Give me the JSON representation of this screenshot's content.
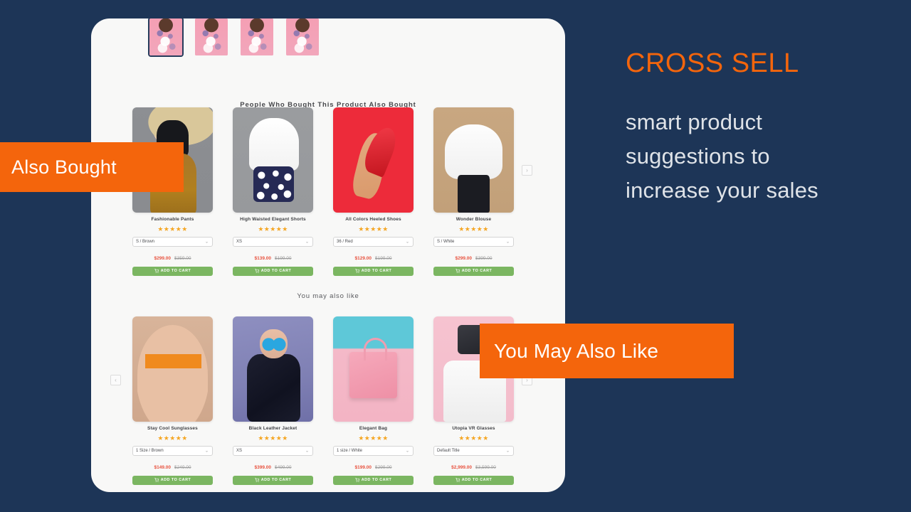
{
  "colors": {
    "background": "#1d3557",
    "accent_orange": "#f4650c",
    "card_background": "#f8f8f7",
    "cart_button_green": "#7bb661",
    "sale_price_red": "#e8523f",
    "star_yellow": "#f5a623"
  },
  "right_panel": {
    "headline": "CROSS SELL",
    "sub_lines": [
      "smart product",
      "suggestions to",
      "increase your sales"
    ]
  },
  "callouts": {
    "also_bought": "Also Bought",
    "you_may_also_like": "You May Also Like"
  },
  "store": {
    "thumbnails": [
      {
        "name": "thumbnail-1",
        "selected": true
      },
      {
        "name": "thumbnail-2",
        "selected": false
      },
      {
        "name": "thumbnail-3",
        "selected": false
      },
      {
        "name": "thumbnail-4",
        "selected": false
      }
    ],
    "carousel": {
      "prev_label": "‹",
      "next_label": "›"
    },
    "add_to_cart_label": "ADD TO CART",
    "stars": "★★★★★",
    "caret": "⌄",
    "sections": [
      {
        "id": "also-bought",
        "title": "People Who Bought This Product Also Bought",
        "products": [
          {
            "name": "Fashionable Pants",
            "variant": "S / Brown",
            "price": "$299.00",
            "compare_at": "$359.00",
            "rating": 5,
            "art": "img-pants"
          },
          {
            "name": "High Waisted Elegant Shorts",
            "variant": "XS",
            "price": "$139.00",
            "compare_at": "$199.00",
            "rating": 5,
            "art": "img-shorts"
          },
          {
            "name": "All Colors Heeled Shoes",
            "variant": "36 / Red",
            "price": "$129.00",
            "compare_at": "$199.00",
            "rating": 5,
            "art": "img-shoes"
          },
          {
            "name": "Wonder Blouse",
            "variant": "S / White",
            "price": "$299.00",
            "compare_at": "$399.00",
            "rating": 5,
            "art": "img-blouse"
          }
        ]
      },
      {
        "id": "you-may-also-like",
        "title": "You may also like",
        "products": [
          {
            "name": "Stay Cool Sunglasses",
            "variant": "1 Size / Brown",
            "price": "$149.00",
            "compare_at": "$249.00",
            "rating": 5,
            "art": "img-sunglasses"
          },
          {
            "name": "Black Leather Jacket",
            "variant": "XS",
            "price": "$399.00",
            "compare_at": "$499.00",
            "rating": 5,
            "art": "img-jacket"
          },
          {
            "name": "Elegant Bag",
            "variant": "1 size / White",
            "price": "$199.00",
            "compare_at": "$299.00",
            "rating": 5,
            "art": "img-bag"
          },
          {
            "name": "Utopia VR Glasses",
            "variant": "Default Title",
            "price": "$2,999.00",
            "compare_at": "$3,599.00",
            "rating": 5,
            "art": "img-vr"
          }
        ]
      }
    ]
  }
}
